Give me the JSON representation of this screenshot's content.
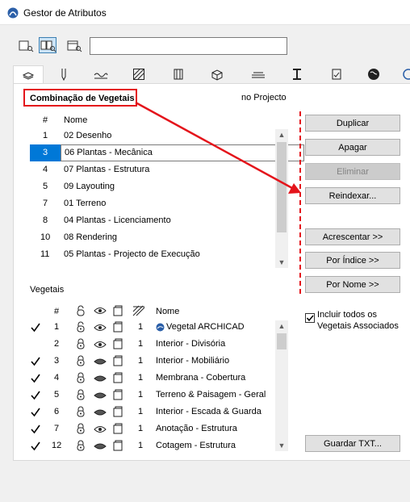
{
  "window": {
    "title": "Gestor de Atributos"
  },
  "annotation": {
    "label": "Combinação de Vegetais"
  },
  "top_list": {
    "sub_label": "no Projecto",
    "col_num": "#",
    "col_name": "Nome",
    "rows": [
      {
        "num": "1",
        "name": "02 Desenho"
      },
      {
        "num": "3",
        "name": "06 Plantas - Mecânica",
        "selected": true
      },
      {
        "num": "4",
        "name": "07 Plantas - Estrutura"
      },
      {
        "num": "5",
        "name": "09 Layouting"
      },
      {
        "num": "7",
        "name": "01 Terreno"
      },
      {
        "num": "8",
        "name": "04 Plantas - Licenciamento"
      },
      {
        "num": "10",
        "name": "08 Rendering"
      },
      {
        "num": "11",
        "name": "05 Plantas - Projecto de Execução"
      }
    ]
  },
  "bottom_list": {
    "section_title": "Vegetais",
    "col_num": "#",
    "col_name": "Nome",
    "rows": [
      {
        "checked": true,
        "num": "1",
        "lock": false,
        "eye": "open",
        "sat": "1",
        "name": "Vegetal ARCHICAD",
        "globe": true
      },
      {
        "checked": false,
        "num": "2",
        "lock": true,
        "eye": "open",
        "sat": "1",
        "name": "Interior - Divisória"
      },
      {
        "checked": true,
        "num": "3",
        "lock": true,
        "eye": "closed",
        "sat": "1",
        "name": "Interior - Mobiliário"
      },
      {
        "checked": true,
        "num": "4",
        "lock": true,
        "eye": "closed",
        "sat": "1",
        "name": "Membrana - Cobertura"
      },
      {
        "checked": true,
        "num": "5",
        "lock": true,
        "eye": "closed",
        "sat": "1",
        "name": "Terreno & Paisagem - Geral"
      },
      {
        "checked": true,
        "num": "6",
        "lock": true,
        "eye": "closed",
        "sat": "1",
        "name": "Interior - Escada & Guarda"
      },
      {
        "checked": true,
        "num": "7",
        "lock": true,
        "eye": "open",
        "sat": "1",
        "name": "Anotação - Estrutura"
      },
      {
        "checked": true,
        "num": "12",
        "lock": true,
        "eye": "closed",
        "sat": "1",
        "name": "Cotagem - Estrutura"
      }
    ]
  },
  "buttons": {
    "duplicar": "Duplicar",
    "apagar": "Apagar",
    "eliminar": "Eliminar",
    "reindexar": "Reindexar...",
    "acrescentar": "Acrescentar >>",
    "por_indice": "Por Índice >>",
    "por_nome": "Por Nome >>",
    "guardar_txt": "Guardar TXT..."
  },
  "include_all": {
    "checked": true,
    "label_line1": "Incluir todos os",
    "label_line2": "Vegetais Associados"
  },
  "search": {
    "value": ""
  },
  "colors": {
    "selection": "#0078d7",
    "annotation_red": "#e4141b"
  }
}
